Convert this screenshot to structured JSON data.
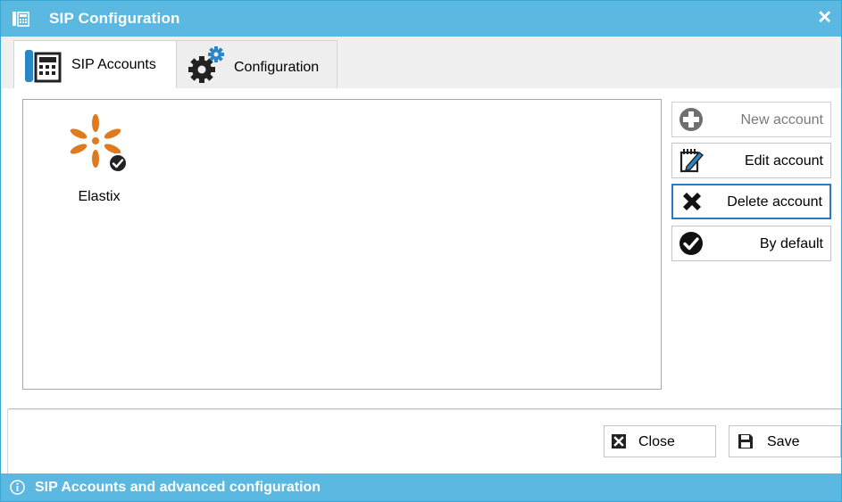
{
  "window": {
    "title": "SIP Configuration",
    "close_glyph": "✕",
    "app_icon": "phone-keypad-icon",
    "colors": {
      "titlebar": "#5bb8e0",
      "focus_border": "#2b78c5"
    }
  },
  "tabs": [
    {
      "label": "SIP Accounts",
      "icon": "phone-keypad-icon",
      "active": true
    },
    {
      "label": "Configuration",
      "icon": "gears-icon",
      "active": false
    }
  ],
  "accounts": [
    {
      "label": "Elastix",
      "icon": "elastix-logo",
      "is_default": true
    }
  ],
  "actions": {
    "new_account": "New account",
    "edit_account": "Edit account",
    "delete_account": "Delete account",
    "by_default": "By default"
  },
  "footer": {
    "close_label": "Close",
    "save_label": "Save"
  },
  "status": {
    "text": "SIP Accounts and advanced configuration",
    "icon": "info-icon"
  }
}
